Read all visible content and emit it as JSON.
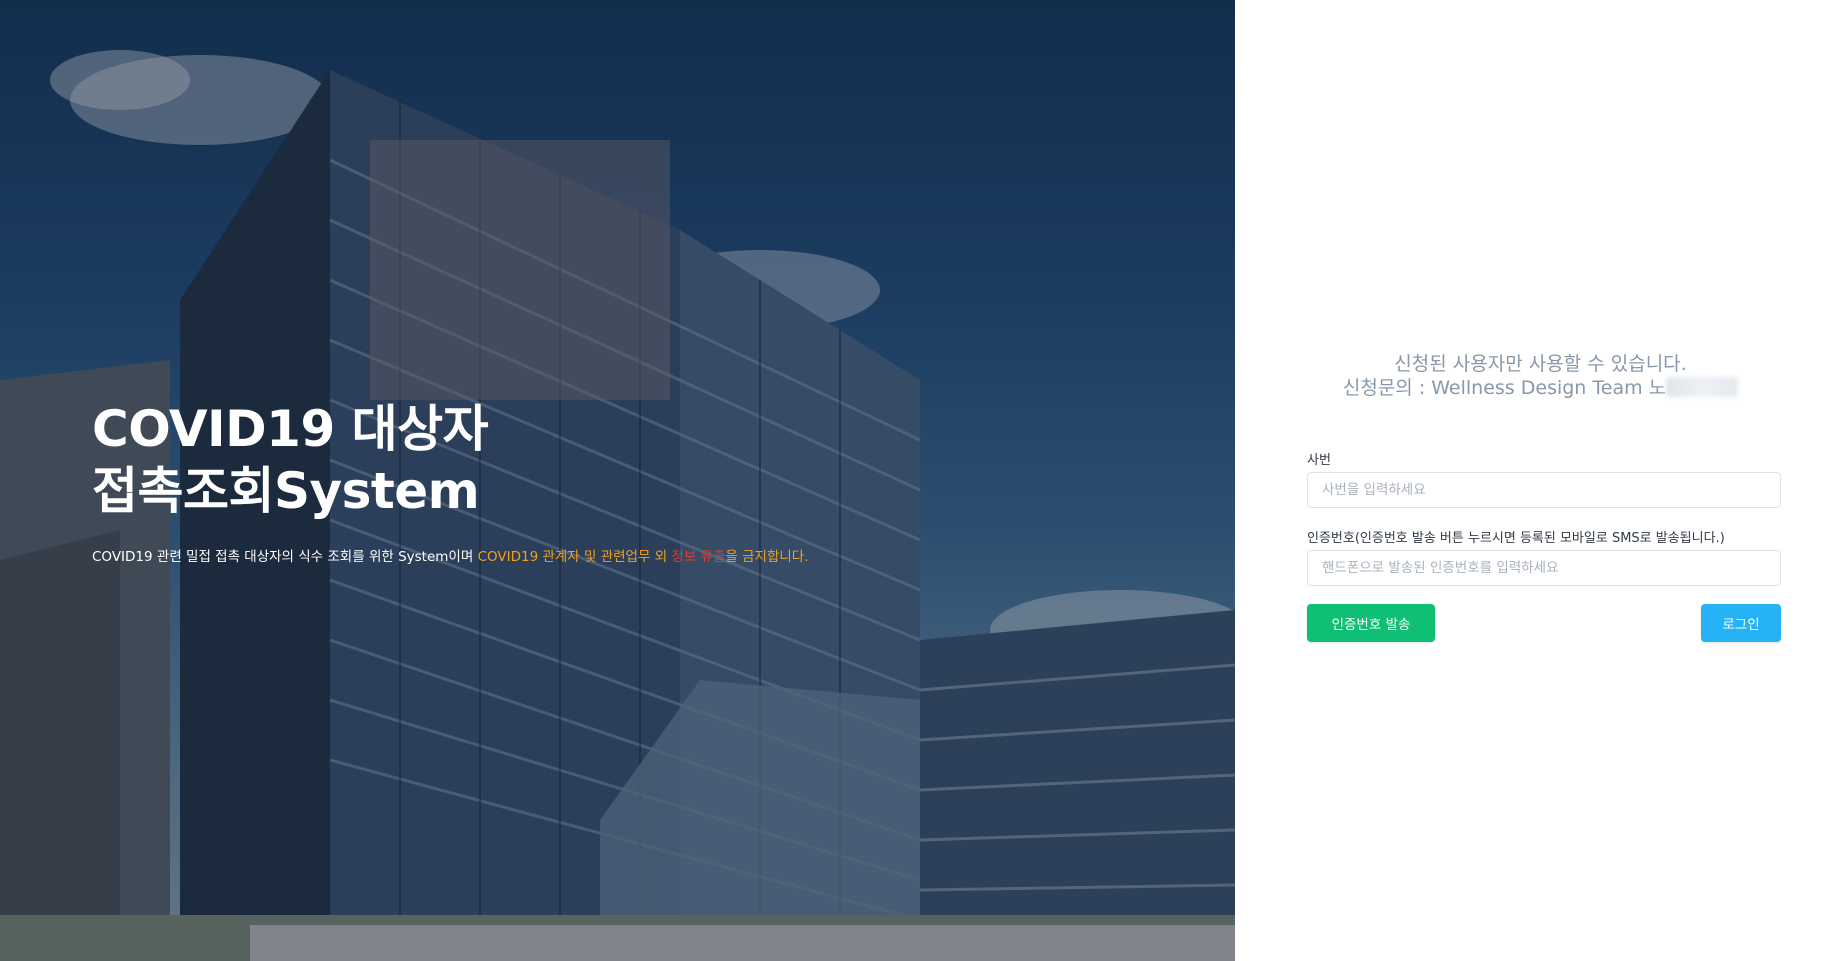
{
  "hero": {
    "title_line1": "COVID19 대상자",
    "title_line2": "접촉조회System",
    "desc_plain": "COVID19 관련 밀접 접촉 대상자의 식수 조회를 위한 System이며 ",
    "desc_warn1": "COVID19 관계자 및 관련업무 외 ",
    "desc_red": "정보 유출",
    "desc_warn2": "을 금지합니다."
  },
  "notice": {
    "line1": "신청된 사용자만 사용할 수 있습니다.",
    "line2": "신청문의 : Wellness Design Team 노"
  },
  "form": {
    "employee_label": "사번",
    "employee_placeholder": "사번을 입력하세요",
    "code_label": "인증번호(인증번호 발송 버튼 누르시면 등록된 모바일로 SMS로 발송됩니다.)",
    "code_placeholder": "핸드폰으로 발송된 인증번호를 입력하세요",
    "send_button": "인증번호 발송",
    "login_button": "로그인"
  },
  "colors": {
    "send_button": "#0fbf73",
    "login_button": "#25b3f5",
    "warn_text": "#f2a01e",
    "red_text": "#e53a2a",
    "notice_text": "#8898aa"
  }
}
